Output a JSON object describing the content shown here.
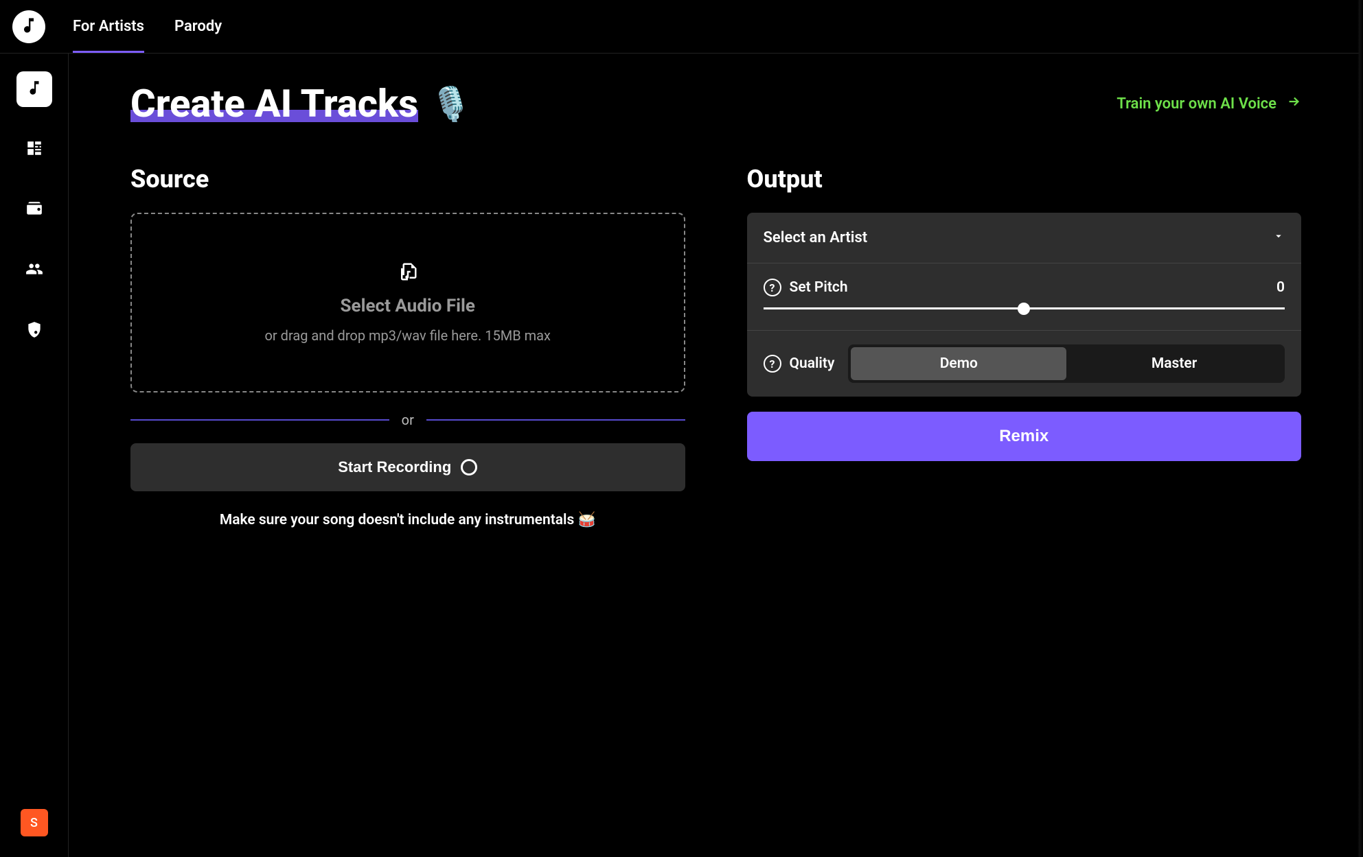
{
  "topnav": {
    "tabs": [
      {
        "label": "For Artists",
        "active": true
      },
      {
        "label": "Parody",
        "active": false
      }
    ]
  },
  "sidebar": {
    "avatar_letter": "S"
  },
  "page": {
    "title": "Create AI Tracks",
    "title_emoji": "🎙️",
    "train_link": "Train your own AI Voice"
  },
  "source": {
    "heading": "Source",
    "dropzone_title": "Select Audio File",
    "dropzone_sub": "or drag and drop mp3/wav file here. 15MB max",
    "or_label": "or",
    "record_label": "Start Recording",
    "hint_text": "Make sure your song doesn't include any instrumentals 🥁"
  },
  "output": {
    "heading": "Output",
    "artist_placeholder": "Select an Artist",
    "pitch_label": "Set Pitch",
    "pitch_value": "0",
    "quality_label": "Quality",
    "quality_options": {
      "demo": "Demo",
      "master": "Master"
    },
    "remix_label": "Remix"
  }
}
